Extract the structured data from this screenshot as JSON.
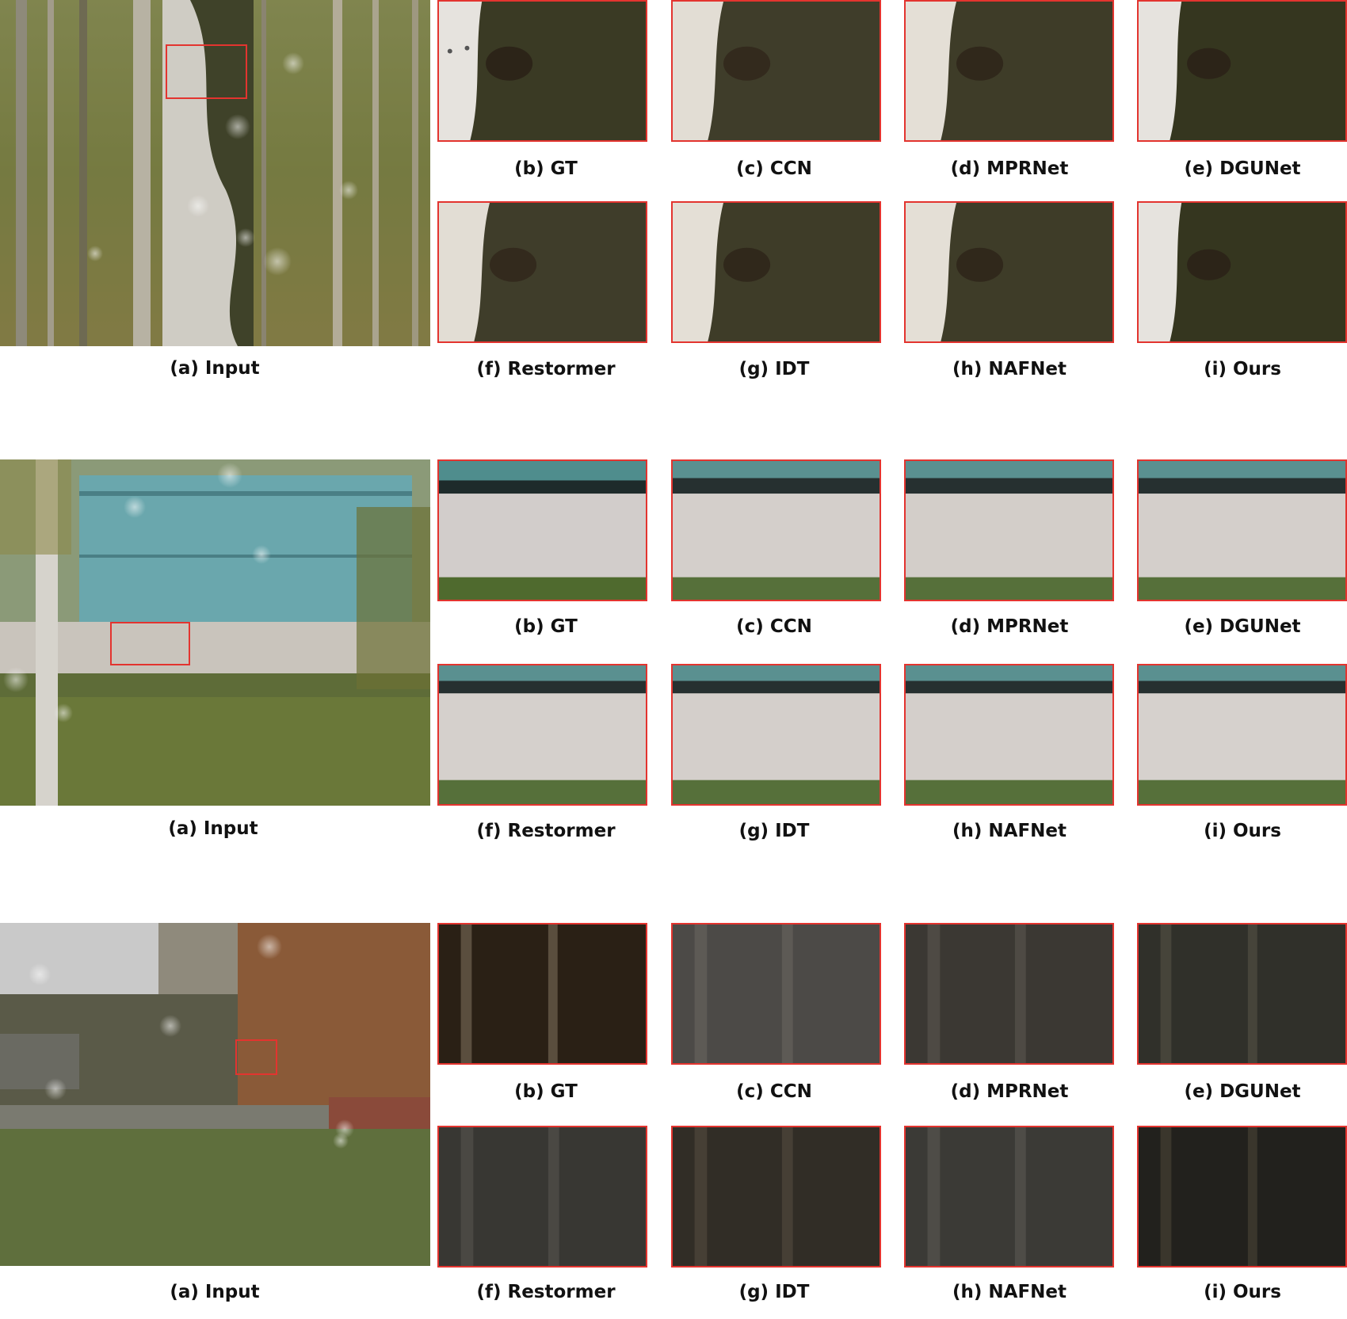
{
  "figure": {
    "groups": [
      {
        "input_caption": "(a) Input",
        "captions": [
          "(b) GT",
          "(c) CCN",
          "(d) MPRNet",
          "(e) DGUNet",
          "(f) Restormer",
          "(g) IDT",
          "(h) NAFNet",
          "(i) Ours"
        ],
        "scene": "forest-birch"
      },
      {
        "input_caption": "(a) Input",
        "captions": [
          "(b) GT",
          "(c) CCN",
          "(d) MPRNet",
          "(e) DGUNet",
          "(f) Restormer",
          "(g) IDT",
          "(h) NAFNet",
          "(i) Ours"
        ],
        "scene": "building-wall"
      },
      {
        "input_caption": "(a) Input",
        "captions": [
          "(b) GT",
          "(c) CCN",
          "(d) MPRNet",
          "(e) DGUNet",
          "(f) Restormer",
          "(g) IDT",
          "(h) NAFNet",
          "(i) Ours"
        ],
        "scene": "park-lawn"
      }
    ],
    "colors": {
      "roi_box": "#e3342f"
    }
  }
}
